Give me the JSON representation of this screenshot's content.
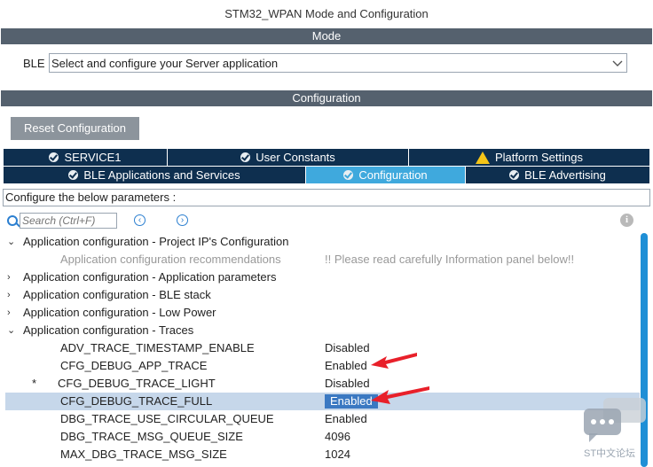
{
  "window": {
    "title": "STM32_WPAN Mode and Configuration"
  },
  "mode_band": "Mode",
  "ble": {
    "label": "BLE",
    "selected": "Select and configure your Server application"
  },
  "config_band": "Configuration",
  "reset_button": "Reset Configuration",
  "tabs_row1": [
    {
      "label": "SERVICE1",
      "icon": "check-icon"
    },
    {
      "label": "User Constants",
      "icon": "check-icon"
    },
    {
      "label": "Platform Settings",
      "icon": "warning-icon"
    }
  ],
  "tabs_row2": [
    {
      "label": "BLE Applications and Services",
      "icon": "check-icon"
    },
    {
      "label": "Configuration",
      "icon": "check-icon",
      "active": true
    },
    {
      "label": "BLE Advertising",
      "icon": "check-icon"
    }
  ],
  "params_label": "Configure the below parameters :",
  "search": {
    "placeholder": "Search (Ctrl+F)"
  },
  "tree": [
    {
      "arrow": "expanded",
      "name": "Application configuration - Project IP's Configuration",
      "value": ""
    },
    {
      "arrow": "",
      "name": "Application configuration recommendations",
      "value": "!! Please read carefully Information panel below!!",
      "grey": true
    },
    {
      "arrow": "collapsed",
      "name": "Application configuration - Application parameters",
      "value": ""
    },
    {
      "arrow": "collapsed",
      "name": "Application configuration - BLE stack",
      "value": ""
    },
    {
      "arrow": "collapsed",
      "name": "Application configuration - Low Power",
      "value": ""
    },
    {
      "arrow": "expanded",
      "name": "Application configuration - Traces",
      "value": ""
    },
    {
      "arrow": "",
      "name": "ADV_TRACE_TIMESTAMP_ENABLE",
      "value": "Disabled"
    },
    {
      "arrow": "",
      "name": "CFG_DEBUG_APP_TRACE",
      "value": "Enabled"
    },
    {
      "arrow": "",
      "name": "CFG_DEBUG_TRACE_LIGHT",
      "value": "Disabled",
      "marker": "*"
    },
    {
      "arrow": "",
      "name": "CFG_DEBUG_TRACE_FULL",
      "value": "Enabled",
      "selected": true
    },
    {
      "arrow": "",
      "name": "DBG_TRACE_USE_CIRCULAR_QUEUE",
      "value": "Enabled"
    },
    {
      "arrow": "",
      "name": "DBG_TRACE_MSG_QUEUE_SIZE",
      "value": "4096"
    },
    {
      "arrow": "",
      "name": "MAX_DBG_TRACE_MSG_SIZE",
      "value": "1024"
    }
  ],
  "watermark": "ST中文论坛",
  "colors": {
    "tab_dark": "#0e2f4f",
    "tab_active": "#3fa9dd",
    "band": "#55616e",
    "accent_arrow": "#e8202a",
    "selection": "#c6d7ea"
  }
}
